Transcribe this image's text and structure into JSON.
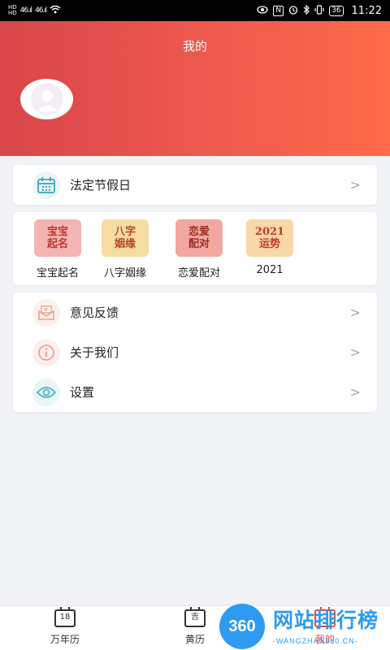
{
  "status_bar": {
    "hd1": "HD",
    "hd2": "HD",
    "sig1": "46.ıl",
    "sig2": "46.ıl",
    "nfc": "N",
    "battery": "36",
    "time": "11:22"
  },
  "header": {
    "title": "我的"
  },
  "holiday_card": {
    "label": "法定节假日",
    "icon": "calendar-icon",
    "color": "#3aa6b5"
  },
  "tools": [
    {
      "label": "宝宝起名",
      "img_text": "宝宝\n起名",
      "bg": "#f4b4b4",
      "fg": "#c0392b"
    },
    {
      "label": "八字姻缘",
      "img_text": "八字\n姻缘",
      "bg": "#f7dca0",
      "fg": "#b7472a"
    },
    {
      "label": "恋爱配对",
      "img_text": "恋爱\n配对",
      "bg": "#f2a8a0",
      "fg": "#9b2d20"
    },
    {
      "label": "2021",
      "img_text": "2021\n运势",
      "bg": "#f8d7a8",
      "fg": "#c0392b"
    }
  ],
  "menu": [
    {
      "label": "意见反馈",
      "icon": "mail-icon",
      "color": "#e7a48a"
    },
    {
      "label": "关于我们",
      "icon": "info-icon",
      "color": "#e89a9a"
    },
    {
      "label": "设置",
      "icon": "eye-icon",
      "color": "#4bb5c4"
    }
  ],
  "chevron": ">",
  "tabs": [
    {
      "label": "万年历",
      "icon_text": "18"
    },
    {
      "label": "黄历",
      "icon_text": "吉"
    },
    {
      "label": "我的",
      "icon_text": ""
    }
  ],
  "watermark": {
    "logo": "360",
    "text": "网站排行榜",
    "url": "-WANGZHAN360.CN-"
  }
}
